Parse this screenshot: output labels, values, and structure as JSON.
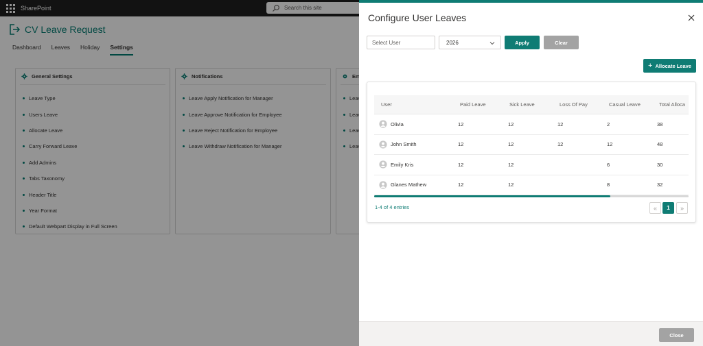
{
  "topbar": {
    "app_name": "SharePoint",
    "search_placeholder": "Search this site"
  },
  "site": {
    "title": "CV Leave Request",
    "nav": [
      "Dashboard",
      "Leaves",
      "Holiday",
      "Settings"
    ],
    "active_nav": "Settings"
  },
  "cards": [
    {
      "title": "General Settings",
      "items": [
        "Leave Type",
        "Users Leave",
        "Allocate Leave",
        "Carry Forward Leave",
        "Add Admins",
        "Tabs Taxonomy",
        "Header Title",
        "Year Format",
        "Default Webpart Display in Full Screen"
      ]
    },
    {
      "title": "Notifications",
      "items": [
        "Leave Apply Notification for Manager",
        "Leave Approve Notification for Employee",
        "Leave Reject Notification for Employee",
        "Leave Withdraw Notification for Manager"
      ]
    },
    {
      "title": "Em",
      "items": [
        "Leav",
        "Leav",
        "Leav",
        "Leav"
      ]
    }
  ],
  "panel": {
    "title": "Configure User Leaves",
    "select_user_placeholder": "Select User",
    "year": "2026",
    "apply_label": "Apply",
    "clear_label": "Clear",
    "allocate_label": "Allocate Leave",
    "columns": [
      "User",
      "Paid Leave",
      "Sick Leave",
      "Loss Of Pay",
      "Casual Leave",
      "Total Alloca"
    ],
    "rows": [
      {
        "user": "Olivia",
        "paid": "12",
        "sick": "12",
        "lop": "12",
        "casual": "2",
        "total": "38"
      },
      {
        "user": "John Smith",
        "paid": "12",
        "sick": "12",
        "lop": "12",
        "casual": "12",
        "total": "48"
      },
      {
        "user": "Emily Kris",
        "paid": "12",
        "sick": "12",
        "lop": "",
        "casual": "6",
        "total": "30"
      },
      {
        "user": "Glanes Mathew",
        "paid": "12",
        "sick": "12",
        "lop": "",
        "casual": "8",
        "total": "32"
      }
    ],
    "entries_text": "1-4 of 4 entries",
    "pagination": {
      "prev": "«",
      "current": "1",
      "next": "»"
    },
    "horizontal_scroll_fraction": 0.75,
    "close_label": "Close"
  },
  "colors": {
    "accent": "#0f7c74",
    "disabled_button": "#a3a3a3",
    "topbar": "#1f1f1f"
  },
  "icons": [
    "waffle-icon",
    "search-icon",
    "site-logo-icon",
    "gear-icon",
    "close-icon",
    "chevron-down-icon",
    "plus-icon",
    "user-avatar-icon"
  ]
}
